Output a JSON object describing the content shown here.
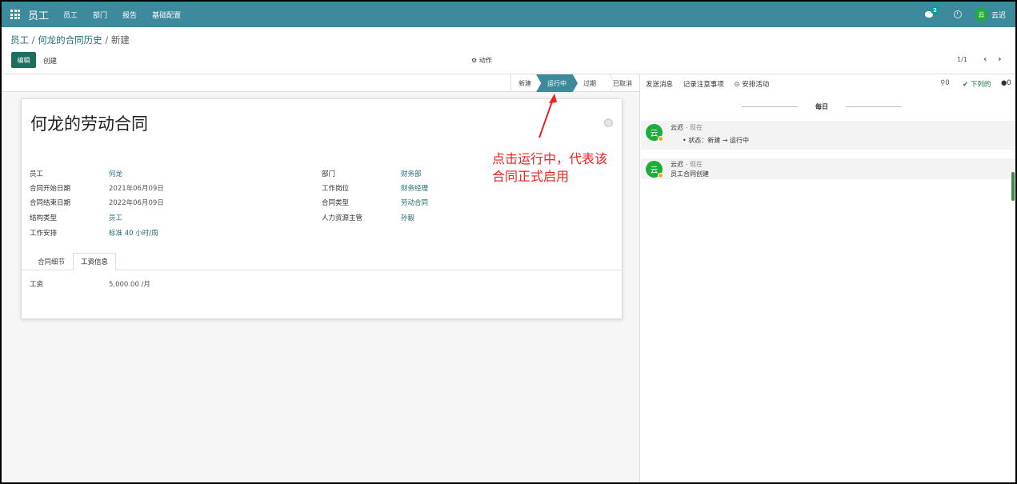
{
  "topbar": {
    "app_title": "员工",
    "nav": [
      "员工",
      "部门",
      "报告",
      "基础配置"
    ],
    "chat_badge": "2",
    "user_avatar": "云",
    "user_name": "云迟",
    "theme_color": "#3d8a9c"
  },
  "breadcrumb": {
    "parent1": "员工",
    "parent2": "何龙的合同历史",
    "current": "新建",
    "sep": "/"
  },
  "toolbar": {
    "edit_label": "编辑",
    "create_label": "创建",
    "action_label": "⚙ 动作",
    "pager": "1/1",
    "prev": "‹",
    "next": "›"
  },
  "statusbar": {
    "stages": [
      "新建",
      "运行中",
      "过期",
      "已取消"
    ],
    "active": "运行中"
  },
  "form": {
    "title": "何龙的劳动合同",
    "left_fields": [
      {
        "label": "员工",
        "value": "何龙"
      },
      {
        "label": "合同开始日期",
        "value": "2021年06月09日"
      },
      {
        "label": "合同结束日期",
        "value": "2022年06月09日"
      },
      {
        "label": "结构类型",
        "value": "员工"
      },
      {
        "label": "工作安排",
        "value": "标准 40 小时/周"
      }
    ],
    "right_fields": [
      {
        "label": "部门",
        "value": "财务部"
      },
      {
        "label": "工作岗位",
        "value": "财务经理"
      },
      {
        "label": "合同类型",
        "value": "劳动合同"
      },
      {
        "label": "人力资源主管",
        "value": "孙毅"
      }
    ],
    "tabs": [
      "合同细节",
      "工资信息"
    ],
    "active_tab": "工资信息",
    "wage_label": "工资",
    "wage_value": "5,000.00 /月"
  },
  "chatter": {
    "send_message": "发送消息",
    "log_note": "记录注意事项",
    "schedule_activity": "⊙ 安排活动",
    "attachments": "0",
    "follow_label": "✔ 下列的",
    "followers": "0",
    "day_separator": "每日",
    "messages": [
      {
        "avatar": "云",
        "author": "云迟",
        "time": "- 现在",
        "body": "•  状态：新建 → 运行中"
      },
      {
        "avatar": "云",
        "author": "云迟",
        "time": "- 现在",
        "body": "员工合同创建"
      }
    ]
  },
  "annotation": {
    "line1": "点击运行中，代表该",
    "line2": "合同正式启用",
    "color": "#ee2222"
  }
}
